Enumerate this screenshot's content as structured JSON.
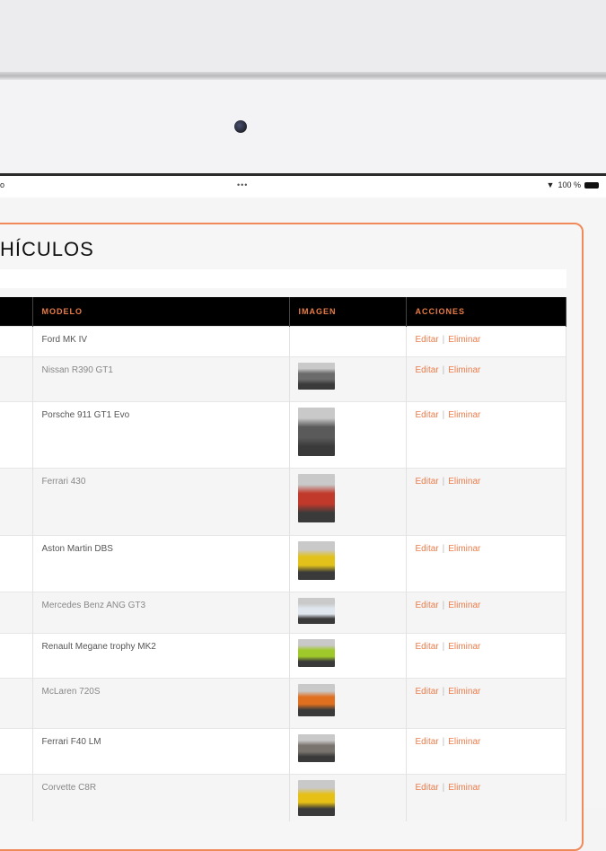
{
  "status_bar": {
    "dots": "•••",
    "battery": "100 %",
    "left": "o"
  },
  "page": {
    "title": "HÍCULOS"
  },
  "table": {
    "headers": [
      "",
      "MODELO",
      "IMAGEN",
      "ACCIONES"
    ],
    "edit_label": "Editar",
    "delete_label": "Eliminar",
    "separator": "|",
    "rows": [
      {
        "model": "Ford MK IV",
        "thumb": null
      },
      {
        "model": "Nissan R390 GT1",
        "thumb": "#6b6b6b"
      },
      {
        "model": "Porsche 911 GT1 Evo",
        "thumb": "#5a5a5a"
      },
      {
        "model": "Ferrari 430",
        "thumb": "#c0392b"
      },
      {
        "model": "Aston Martin DBS",
        "thumb": "#e2c21a"
      },
      {
        "model": "Mercedes Benz ANG GT3",
        "thumb": "#dfe6ee"
      },
      {
        "model": "Renault Megane trophy MK2",
        "thumb": "#9fc92a"
      },
      {
        "model": "McLaren 720S",
        "thumb": "#e07020"
      },
      {
        "model": "Ferrari F40 LM",
        "thumb": "#7a746e"
      },
      {
        "model": "Corvette C8R",
        "thumb": "#e6c015"
      }
    ]
  }
}
